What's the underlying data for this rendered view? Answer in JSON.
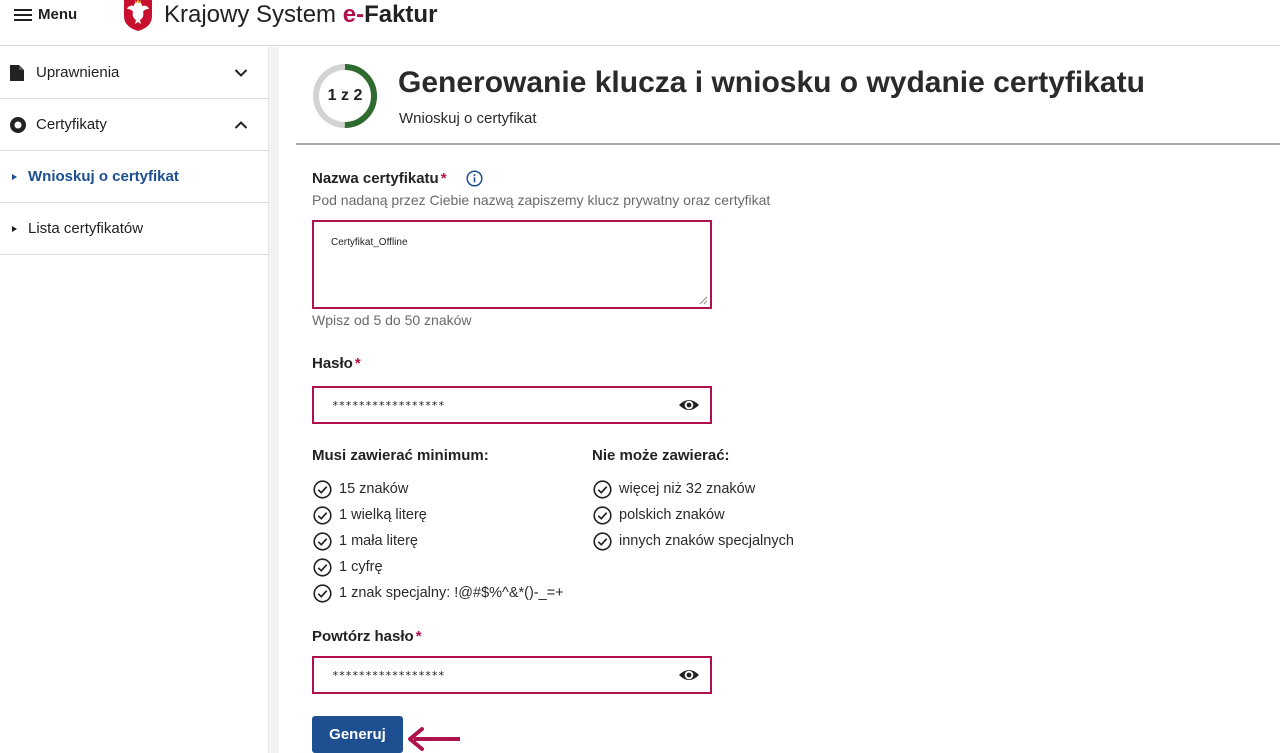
{
  "topbar": {
    "menu_label": "Menu",
    "brand_text": "Krajowy System ",
    "brand_accent": "e-",
    "brand_bold": "Faktur"
  },
  "sidebar": {
    "items": [
      {
        "label": "Uprawnienia",
        "icon": "document-icon",
        "expanded": false
      },
      {
        "label": "Certyfikaty",
        "icon": "certificate-icon",
        "expanded": true
      }
    ],
    "subitems": [
      {
        "label": "Wnioskuj o certyfikat",
        "active": true
      },
      {
        "label": "Lista certyfikatów",
        "active": false
      }
    ]
  },
  "header": {
    "step": "1 z 2",
    "step_progress": 0.5,
    "title": "Generowanie klucza i wniosku o wydanie certyfikatu",
    "subtitle": "Wnioskuj o certyfikat"
  },
  "form": {
    "name": {
      "label": "Nazwa certyfikatu",
      "required_mark": "*",
      "hint": "Pod nadaną przez Ciebie nazwą zapiszemy klucz prywatny oraz certyfikat",
      "value": "Certyfikat_Offline",
      "helper": "Wpisz od 5 do 50 znaków"
    },
    "password": {
      "label": "Hasło",
      "required_mark": "*",
      "value": "*****************"
    },
    "must_contain": {
      "title": "Musi zawierać minimum:",
      "items": [
        "15 znaków",
        "1 wielką literę",
        "1 mała literę",
        "1 cyfrę",
        "1 znak specjalny: !@#$%^&*()-_=+"
      ]
    },
    "must_not_contain": {
      "title": "Nie może zawierać:",
      "items": [
        "więcej niż 32 znaków",
        "polskich znaków",
        "innych znaków specjalnych"
      ]
    },
    "repeat_password": {
      "label": "Powtórz hasło",
      "required_mark": "*",
      "value": "*****************"
    },
    "submit_label": "Generuj"
  },
  "colors": {
    "accent": "#b0124e",
    "primary": "#1d4f91",
    "progress": "#2e6b2e"
  }
}
